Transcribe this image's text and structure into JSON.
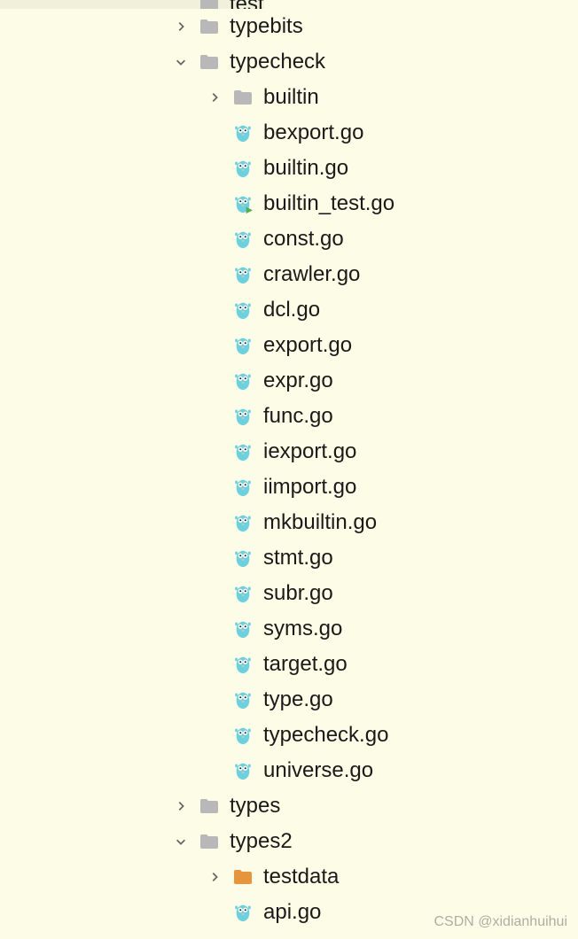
{
  "tree": {
    "items": [
      {
        "indent": 1,
        "arrow": "none-spacer",
        "icon": "folder-grey",
        "label": "test",
        "cutoff": true
      },
      {
        "indent": 1,
        "arrow": "right",
        "icon": "folder-grey",
        "label": "typebits"
      },
      {
        "indent": 1,
        "arrow": "down",
        "icon": "folder-grey",
        "label": "typecheck"
      },
      {
        "indent": 2,
        "arrow": "right",
        "icon": "folder-grey",
        "label": "builtin"
      },
      {
        "indent": 2,
        "arrow": "none",
        "icon": "go-file",
        "label": "bexport.go"
      },
      {
        "indent": 2,
        "arrow": "none",
        "icon": "go-file",
        "label": "builtin.go"
      },
      {
        "indent": 2,
        "arrow": "none",
        "icon": "go-test",
        "label": "builtin_test.go"
      },
      {
        "indent": 2,
        "arrow": "none",
        "icon": "go-file",
        "label": "const.go"
      },
      {
        "indent": 2,
        "arrow": "none",
        "icon": "go-file",
        "label": "crawler.go"
      },
      {
        "indent": 2,
        "arrow": "none",
        "icon": "go-file",
        "label": "dcl.go"
      },
      {
        "indent": 2,
        "arrow": "none",
        "icon": "go-file",
        "label": "export.go"
      },
      {
        "indent": 2,
        "arrow": "none",
        "icon": "go-file",
        "label": "expr.go"
      },
      {
        "indent": 2,
        "arrow": "none",
        "icon": "go-file",
        "label": "func.go"
      },
      {
        "indent": 2,
        "arrow": "none",
        "icon": "go-file",
        "label": "iexport.go"
      },
      {
        "indent": 2,
        "arrow": "none",
        "icon": "go-file",
        "label": "iimport.go"
      },
      {
        "indent": 2,
        "arrow": "none",
        "icon": "go-file",
        "label": "mkbuiltin.go"
      },
      {
        "indent": 2,
        "arrow": "none",
        "icon": "go-file",
        "label": "stmt.go"
      },
      {
        "indent": 2,
        "arrow": "none",
        "icon": "go-file",
        "label": "subr.go"
      },
      {
        "indent": 2,
        "arrow": "none",
        "icon": "go-file",
        "label": "syms.go"
      },
      {
        "indent": 2,
        "arrow": "none",
        "icon": "go-file",
        "label": "target.go"
      },
      {
        "indent": 2,
        "arrow": "none",
        "icon": "go-file",
        "label": "type.go"
      },
      {
        "indent": 2,
        "arrow": "none",
        "icon": "go-file",
        "label": "typecheck.go"
      },
      {
        "indent": 2,
        "arrow": "none",
        "icon": "go-file",
        "label": "universe.go"
      },
      {
        "indent": 1,
        "arrow": "right",
        "icon": "folder-grey",
        "label": "types"
      },
      {
        "indent": 1,
        "arrow": "down",
        "icon": "folder-grey",
        "label": "types2"
      },
      {
        "indent": 2,
        "arrow": "right",
        "icon": "folder-orange",
        "label": "testdata"
      },
      {
        "indent": 2,
        "arrow": "none",
        "icon": "go-file",
        "label": "api.go"
      }
    ]
  },
  "watermark": "CSDN @xidianhuihui"
}
